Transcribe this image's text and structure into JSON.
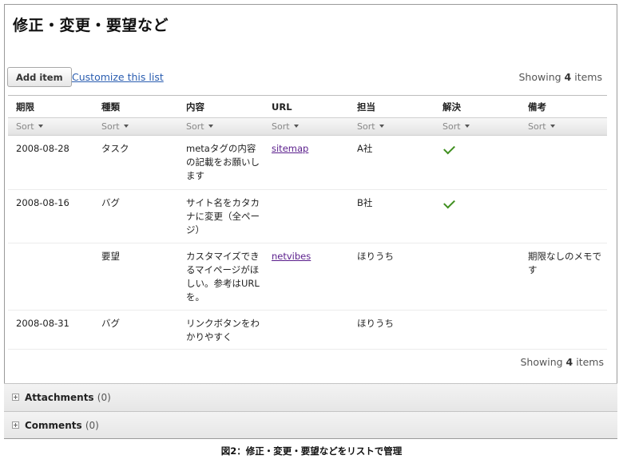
{
  "page": {
    "title": "修正・変更・要望など"
  },
  "toolbar": {
    "add_label": "Add item",
    "customize_label": "Customize this list",
    "showing_prefix": "Showing",
    "showing_count": "4",
    "showing_suffix": "items"
  },
  "table": {
    "headers": [
      "期限",
      "種類",
      "内容",
      "URL",
      "担当",
      "解決",
      "備考"
    ],
    "sort_label": "Sort",
    "rows": [
      {
        "due": "2008-08-28",
        "type": "タスク",
        "content": "metaタグの内容の記載をお願いします",
        "url": "sitemap",
        "owner": "A社",
        "resolved": true,
        "note": ""
      },
      {
        "due": "2008-08-16",
        "type": "バグ",
        "content": "サイト名をカタカナに変更（全ページ）",
        "url": "",
        "owner": "B社",
        "resolved": true,
        "note": ""
      },
      {
        "due": "",
        "type": "要望",
        "content": "カスタマイズできるマイページがほしい。参考はURLを。",
        "url": "netvibes",
        "owner": "ほりうち",
        "resolved": false,
        "note": "期限なしのメモです"
      },
      {
        "due": "2008-08-31",
        "type": "バグ",
        "content": "リンクボタンをわかりやすく",
        "url": "",
        "owner": "ほりうち",
        "resolved": false,
        "note": ""
      }
    ]
  },
  "footer": {
    "showing_prefix": "Showing",
    "showing_count": "4",
    "showing_suffix": "items"
  },
  "sections": {
    "attachments": {
      "label": "Attachments",
      "count": "(0)"
    },
    "comments": {
      "label": "Comments",
      "count": "(0)"
    }
  },
  "caption": "図2：修正・変更・要望などをリストで管理",
  "icons": {
    "resolved": "checkmark-icon",
    "expand": "plus-box-icon",
    "sort": "caret-down-icon"
  },
  "colors": {
    "link": "#2a5db0",
    "visited_link": "#5a1e8c",
    "check": "#3f8f1f"
  }
}
